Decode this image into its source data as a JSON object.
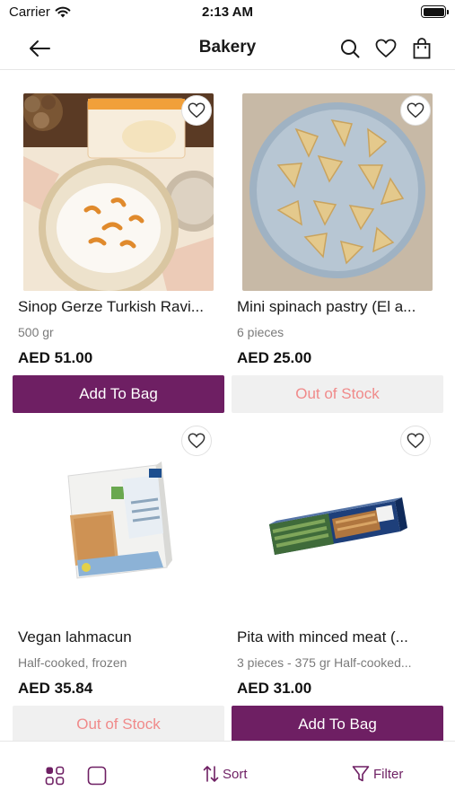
{
  "status_bar": {
    "carrier": "Carrier",
    "time": "2:13 AM"
  },
  "nav": {
    "title": "Bakery",
    "back_icon": "arrow-left-icon",
    "icons": [
      "search-icon",
      "heart-icon",
      "bag-icon"
    ]
  },
  "colors": {
    "brand": "#6e1f63",
    "out_of_stock_text": "#f08a8a",
    "out_of_stock_bg": "#f0f0f0"
  },
  "products": [
    {
      "name": "Sinop Gerze Turkish Ravi...",
      "desc": "500 gr",
      "price": "AED 51.00",
      "button": "Add To Bag",
      "in_stock": true
    },
    {
      "name": "Mini spinach pastry (El a...",
      "desc": "6 pieces",
      "price": "AED 25.00",
      "button": "Out of Stock",
      "in_stock": false
    },
    {
      "name": "Vegan lahmacun",
      "desc": "Half-cooked, frozen",
      "price": "AED 35.84",
      "button": "Out of Stock",
      "in_stock": false
    },
    {
      "name": "Pita with minced meat (...",
      "desc": "3 pieces - 375 gr Half-cooked...",
      "price": "AED 31.00",
      "button": "Add To Bag",
      "in_stock": true
    }
  ],
  "bottom_bar": {
    "sort_label": "Sort",
    "filter_label": "Filter"
  }
}
